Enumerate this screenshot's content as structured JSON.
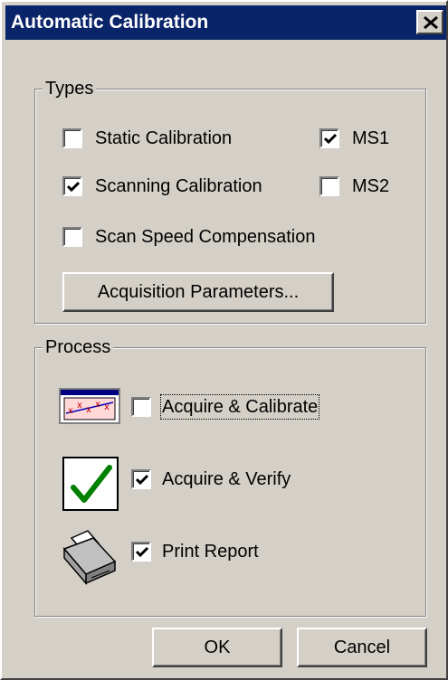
{
  "window": {
    "title": "Automatic Calibration"
  },
  "types": {
    "title": "Types",
    "static_calibration": {
      "label": "Static Calibration",
      "checked": false
    },
    "scanning_calibration": {
      "label": "Scanning Calibration",
      "checked": true
    },
    "scan_speed_compensation": {
      "label": "Scan Speed Compensation",
      "checked": false
    },
    "ms1": {
      "label": "MS1",
      "checked": true
    },
    "ms2": {
      "label": "MS2",
      "checked": false
    },
    "acquisition_parameters_label": "Acquisition Parameters..."
  },
  "process": {
    "title": "Process",
    "acquire_calibrate": {
      "label": "Acquire & Calibrate",
      "checked": false,
      "icon": "calibration-chart-icon"
    },
    "acquire_verify": {
      "label": "Acquire & Verify",
      "checked": true,
      "icon": "checkmark-icon"
    },
    "print_report": {
      "label": "Print Report",
      "checked": true,
      "icon": "printer-icon"
    }
  },
  "buttons": {
    "ok": "OK",
    "cancel": "Cancel"
  },
  "colors": {
    "titlebar": "#0a246a",
    "face": "#d4d0c8",
    "check_green": "#008000"
  }
}
